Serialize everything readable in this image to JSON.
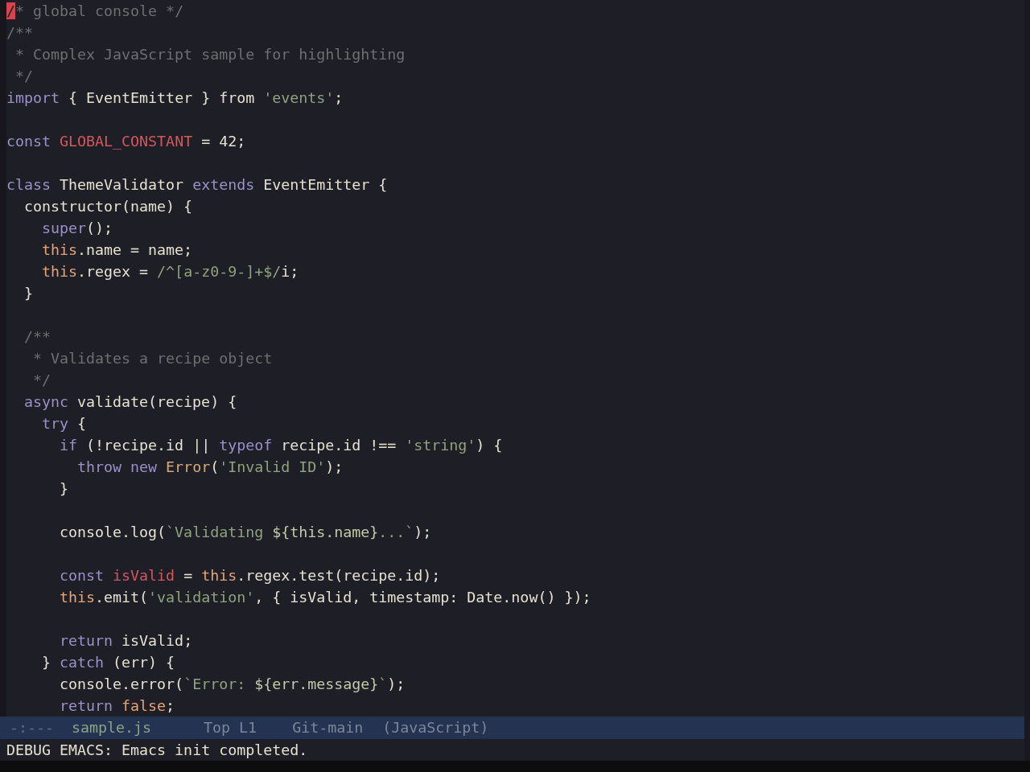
{
  "editor": {
    "lines": [
      {
        "kind": "code",
        "tokens": [
          {
            "kind": "cursor",
            "text": "/"
          },
          {
            "kind": "comment",
            "text": "* global console */"
          }
        ]
      },
      {
        "kind": "code",
        "tokens": [
          {
            "kind": "comment",
            "text": "/**"
          }
        ]
      },
      {
        "kind": "code",
        "tokens": [
          {
            "kind": "comment",
            "text": " * Complex JavaScript sample for highlighting"
          }
        ]
      },
      {
        "kind": "code",
        "tokens": [
          {
            "kind": "comment",
            "text": " */"
          }
        ]
      },
      {
        "kind": "code",
        "tokens": [
          {
            "kind": "keyword",
            "text": "import"
          },
          {
            "kind": "plain",
            "text": " { EventEmitter } from "
          },
          {
            "kind": "string",
            "text": "'events'"
          },
          {
            "kind": "plain",
            "text": ";"
          }
        ]
      },
      {
        "kind": "blank"
      },
      {
        "kind": "code",
        "tokens": [
          {
            "kind": "keyword",
            "text": "const "
          },
          {
            "kind": "constant",
            "text": "GLOBAL_CONSTANT"
          },
          {
            "kind": "plain",
            "text": " = 42;"
          }
        ]
      },
      {
        "kind": "blank"
      },
      {
        "kind": "code",
        "tokens": [
          {
            "kind": "keyword",
            "text": "class"
          },
          {
            "kind": "plain",
            "text": " ThemeValidator "
          },
          {
            "kind": "keyword",
            "text": "extends"
          },
          {
            "kind": "plain",
            "text": " EventEmitter {"
          }
        ]
      },
      {
        "kind": "code",
        "tokens": [
          {
            "kind": "plain",
            "text": "  constructor(name) {"
          }
        ]
      },
      {
        "kind": "code",
        "tokens": [
          {
            "kind": "keyword",
            "text": "    super"
          },
          {
            "kind": "plain",
            "text": "();"
          }
        ]
      },
      {
        "kind": "code",
        "tokens": [
          {
            "kind": "builtin",
            "text": "    this"
          },
          {
            "kind": "plain",
            "text": ".name = name;"
          }
        ]
      },
      {
        "kind": "code",
        "tokens": [
          {
            "kind": "builtin",
            "text": "    this"
          },
          {
            "kind": "plain",
            "text": ".regex = "
          },
          {
            "kind": "string",
            "text": "/^[a-z0-9-]+$/"
          },
          {
            "kind": "plain",
            "text": "i;"
          }
        ]
      },
      {
        "kind": "code",
        "tokens": [
          {
            "kind": "plain",
            "text": "  }"
          }
        ]
      },
      {
        "kind": "blank"
      },
      {
        "kind": "code",
        "tokens": [
          {
            "kind": "comment",
            "text": "  /**"
          }
        ]
      },
      {
        "kind": "code",
        "tokens": [
          {
            "kind": "comment",
            "text": "   * Validates a recipe object"
          }
        ]
      },
      {
        "kind": "code",
        "tokens": [
          {
            "kind": "comment",
            "text": "   */"
          }
        ]
      },
      {
        "kind": "code",
        "tokens": [
          {
            "kind": "keyword",
            "text": "  async"
          },
          {
            "kind": "plain",
            "text": " validate(recipe) {"
          }
        ]
      },
      {
        "kind": "code",
        "tokens": [
          {
            "kind": "keyword",
            "text": "    try"
          },
          {
            "kind": "plain",
            "text": " {"
          }
        ]
      },
      {
        "kind": "code",
        "tokens": [
          {
            "kind": "keyword",
            "text": "      if"
          },
          {
            "kind": "plain",
            "text": " (!recipe.id || "
          },
          {
            "kind": "keyword",
            "text": "typeof"
          },
          {
            "kind": "plain",
            "text": " recipe.id !== "
          },
          {
            "kind": "string",
            "text": "'string'"
          },
          {
            "kind": "plain",
            "text": ") {"
          }
        ]
      },
      {
        "kind": "code",
        "tokens": [
          {
            "kind": "keyword",
            "text": "        throw new "
          },
          {
            "kind": "type",
            "text": "Error"
          },
          {
            "kind": "plain",
            "text": "("
          },
          {
            "kind": "string",
            "text": "'Invalid ID'"
          },
          {
            "kind": "plain",
            "text": ");"
          }
        ]
      },
      {
        "kind": "code",
        "tokens": [
          {
            "kind": "plain",
            "text": "      }"
          }
        ]
      },
      {
        "kind": "blank"
      },
      {
        "kind": "code",
        "tokens": [
          {
            "kind": "plain",
            "text": "      console.log("
          },
          {
            "kind": "string",
            "text": "`Validating "
          },
          {
            "kind": "interpolation",
            "text": "${this.name}"
          },
          {
            "kind": "string",
            "text": "...`"
          },
          {
            "kind": "plain",
            "text": ");"
          }
        ]
      },
      {
        "kind": "blank"
      },
      {
        "kind": "code",
        "tokens": [
          {
            "kind": "keyword",
            "text": "      const "
          },
          {
            "kind": "constant",
            "text": "isValid"
          },
          {
            "kind": "plain",
            "text": " = "
          },
          {
            "kind": "builtin",
            "text": "this"
          },
          {
            "kind": "plain",
            "text": ".regex.test(recipe.id);"
          }
        ]
      },
      {
        "kind": "code",
        "tokens": [
          {
            "kind": "builtin",
            "text": "      this"
          },
          {
            "kind": "plain",
            "text": ".emit("
          },
          {
            "kind": "string",
            "text": "'validation'"
          },
          {
            "kind": "plain",
            "text": ", { isValid, timestamp: Date.now() });"
          }
        ]
      },
      {
        "kind": "blank"
      },
      {
        "kind": "code",
        "tokens": [
          {
            "kind": "keyword",
            "text": "      return"
          },
          {
            "kind": "plain",
            "text": " isValid;"
          }
        ]
      },
      {
        "kind": "code",
        "tokens": [
          {
            "kind": "plain",
            "text": "    } "
          },
          {
            "kind": "keyword",
            "text": "catch"
          },
          {
            "kind": "plain",
            "text": " (err) {"
          }
        ]
      },
      {
        "kind": "code",
        "tokens": [
          {
            "kind": "plain",
            "text": "      console.error("
          },
          {
            "kind": "string",
            "text": "`Error: "
          },
          {
            "kind": "interpolation",
            "text": "${err.message}"
          },
          {
            "kind": "string",
            "text": "`"
          },
          {
            "kind": "plain",
            "text": ");"
          }
        ]
      },
      {
        "kind": "code",
        "tokens": [
          {
            "kind": "keyword",
            "text": "      return "
          },
          {
            "kind": "builtin",
            "text": "false"
          },
          {
            "kind": "plain",
            "text": ";"
          }
        ]
      }
    ]
  },
  "mode_line": {
    "status": "-:---",
    "buffer_name": "sample.js",
    "position": "Top L1",
    "vc_branch": "Git-main",
    "major_mode": "(JavaScript)"
  },
  "echo_area": {
    "message": "DEBUG EMACS: Emacs init completed."
  }
}
